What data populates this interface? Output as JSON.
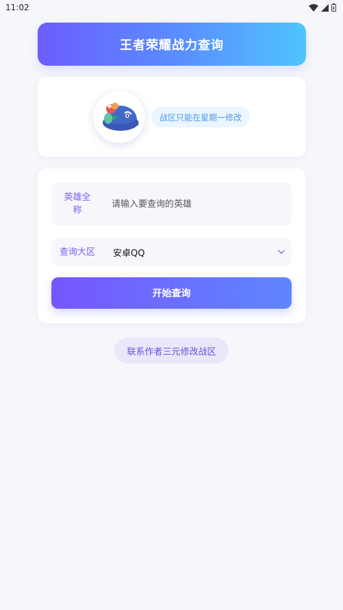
{
  "status_bar": {
    "time": "11:02",
    "icons": [
      "wifi-icon",
      "signal-icon",
      "battery-icon"
    ]
  },
  "header": {
    "title": "王者荣耀战力查询"
  },
  "profile": {
    "avatar": "hero-mascot-avatar",
    "notice": "战区只能在星期一修改"
  },
  "form": {
    "hero_field": {
      "label": "英雄全称",
      "placeholder": "请输入要查询的英雄",
      "value": ""
    },
    "region_field": {
      "label": "查询大区",
      "selected": "安卓QQ"
    },
    "submit_label": "开始查询"
  },
  "contact_button": "联系作者三元修改战区",
  "colors": {
    "accent": "#7656ff",
    "accent_end": "#4fc4ff",
    "notice_text": "#4d9ae6",
    "label_text": "#7a5df0",
    "background": "#f6f7fb"
  }
}
